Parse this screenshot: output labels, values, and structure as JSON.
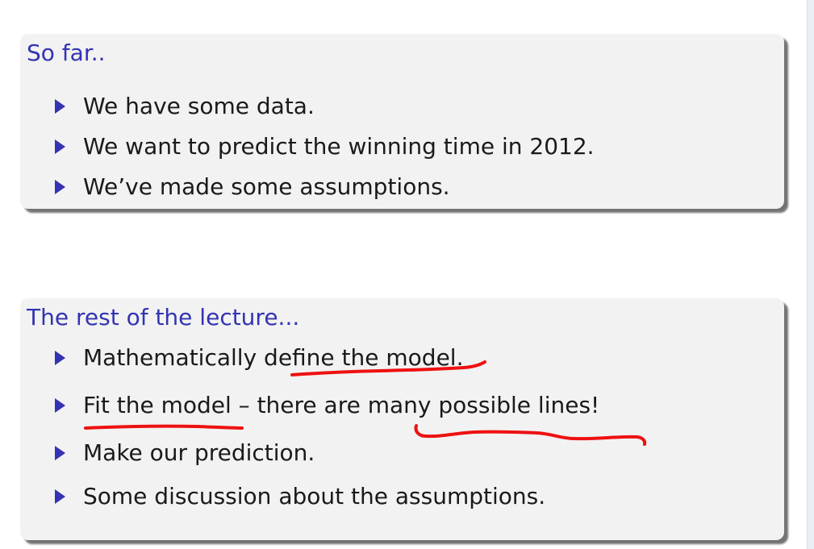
{
  "blocks": [
    {
      "title": "So far..",
      "items": [
        "We have some data.",
        "We want to predict the winning time in 2012.",
        "We’ve made some assumptions."
      ]
    },
    {
      "title": "The rest of the lecture...",
      "items": [
        "Mathematically define the model.",
        "Fit the model – there are many possible lines!",
        "Make our prediction.",
        "Some discussion about the assumptions."
      ]
    }
  ],
  "colors": {
    "title": "#3333b3",
    "bullet": "#3333b3",
    "text": "#1a1a1a",
    "block_background": "#f2f2f2",
    "annotation_ink": "#ee1111"
  }
}
